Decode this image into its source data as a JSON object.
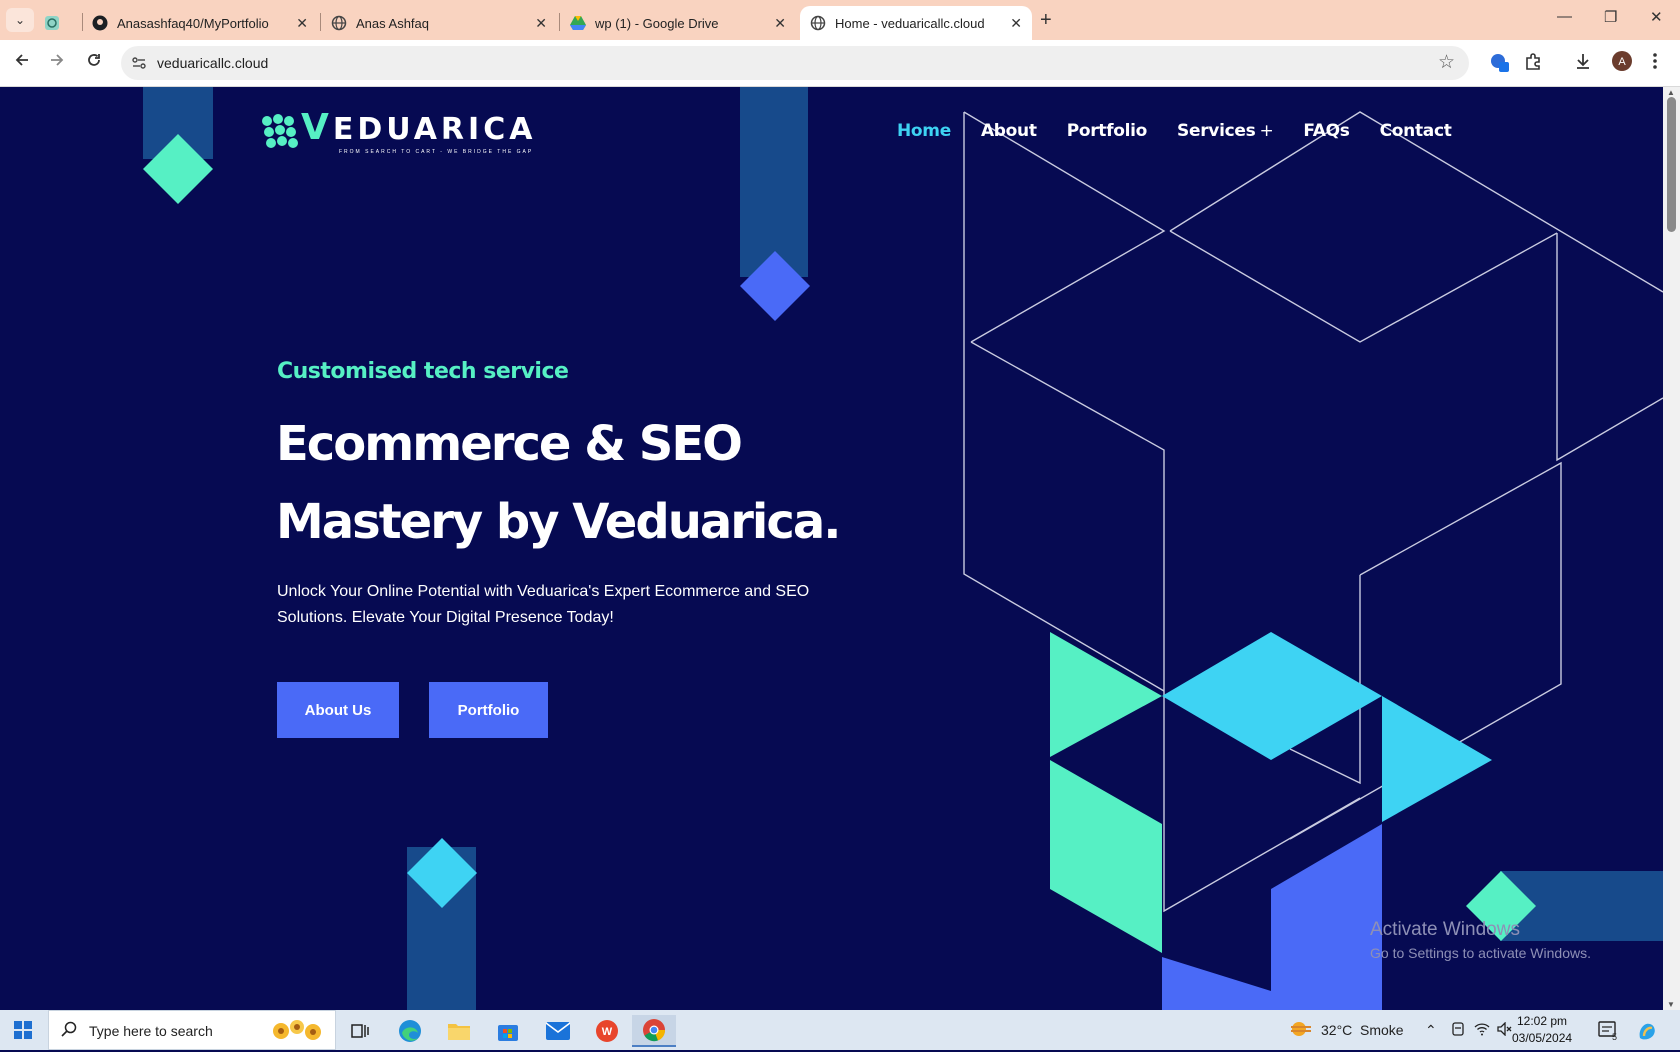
{
  "browser": {
    "tabs": [
      {
        "title": "",
        "icon": "chatgpt-icon"
      },
      {
        "title": "Anasashfaq40/MyPortfolio",
        "icon": "github-icon"
      },
      {
        "title": "Anas Ashfaq",
        "icon": "globe-icon"
      },
      {
        "title": "wp (1) - Google Drive",
        "icon": "google-drive-icon"
      },
      {
        "title": "Home - veduaricallc.cloud",
        "icon": "globe-icon",
        "active": true
      }
    ],
    "url": "veduaricallc.cloud"
  },
  "site": {
    "logo": {
      "letter": "V",
      "rest": "EDUARICA",
      "tagline": "FROM SEARCH TO CART - WE BRIDGE THE GAP"
    },
    "nav": [
      {
        "label": "Home",
        "active": true
      },
      {
        "label": "About"
      },
      {
        "label": "Portfolio"
      },
      {
        "label": "Services"
      },
      {
        "label": "FAQs"
      },
      {
        "label": "Contact"
      }
    ],
    "services_expander": "+",
    "hero": {
      "tagline": "Customised tech service",
      "headline_line1": "Ecommerce & SEO",
      "headline_line2": "Mastery by Veduarica.",
      "description": "Unlock Your Online Potential with Veduarica's Expert Ecommerce and SEO Solutions. Elevate Your Digital Presence Today!",
      "buttons": [
        {
          "label": "About Us"
        },
        {
          "label": "Portfolio"
        }
      ]
    },
    "colors": {
      "background": "#060a52",
      "mint": "#56f0c4",
      "cyan": "#3ed3f3",
      "blue": "#4a6af7",
      "navy_bar": "#174a8b"
    }
  },
  "watermark": {
    "title": "Activate Windows",
    "subtitle": "Go to Settings to activate Windows."
  },
  "taskbar": {
    "search_placeholder": "Type here to search",
    "weather": {
      "temp": "32°C",
      "condition": "Smoke"
    },
    "time": "12:02 pm",
    "date": "03/05/2024",
    "notification_count": "5"
  }
}
